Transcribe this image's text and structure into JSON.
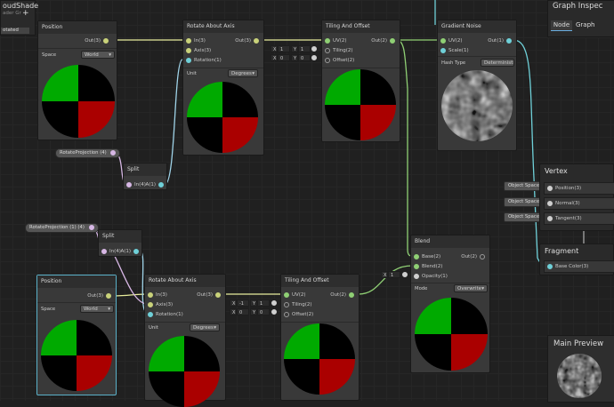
{
  "top_left": {
    "title": "oudShade",
    "subtitle": "ader Gr",
    "button": "otated"
  },
  "graph_inspector": {
    "title": "Graph Inspec",
    "tabs": [
      "Node",
      "Graph"
    ]
  },
  "position_top": {
    "title": "Position",
    "out": "Out(3)",
    "space_label": "Space",
    "space_value": "World"
  },
  "rotate_top": {
    "title": "Rotate About Axis",
    "inputs": [
      "In(3)",
      "Axis(3)",
      "Rotation(1)"
    ],
    "out": "Out(3)",
    "unit_label": "Unit",
    "unit_value": "Degrees"
  },
  "tiling_top": {
    "title": "Tiling And Offset",
    "inputs": [
      "UV(2)",
      "Tiling(2)",
      "Offset(2)"
    ],
    "out": "Out(2)",
    "tiling_vals": {
      "x_label": "X",
      "x": "1",
      "y_label": "Y",
      "y": "1"
    },
    "offset_vals": {
      "x_label": "X",
      "x": "0",
      "y_label": "Y",
      "y": "0"
    }
  },
  "gradient_noise": {
    "title": "Gradient Noise",
    "inputs": [
      "UV(2)",
      "Scale(1)"
    ],
    "out": "Out(1)",
    "hash_label": "Hash Type",
    "hash_value": "Deterministi"
  },
  "rotate_prop_top": {
    "label": "RotateProjection (4)"
  },
  "split_top": {
    "title": "Split",
    "input": "In(4)",
    "out": "A(1)"
  },
  "rotate_prop_bottom": {
    "label": "RotateProjection (1) (4)"
  },
  "split_bottom": {
    "title": "Split",
    "input": "In(4)",
    "out": "A(1)"
  },
  "position_bottom": {
    "title": "Position",
    "out": "Out(3)",
    "space_label": "Space",
    "space_value": "World"
  },
  "rotate_bottom": {
    "title": "Rotate About Axis",
    "inputs": [
      "In(3)",
      "Axis(3)",
      "Rotation(1)"
    ],
    "out": "Out(3)",
    "unit_label": "Unit",
    "unit_value": "Degrees"
  },
  "tiling_bottom": {
    "title": "Tiling And Offset",
    "inputs": [
      "UV(2)",
      "Tiling(2)",
      "Offset(2)"
    ],
    "out": "Out(2)",
    "tiling_vals": {
      "x_label": "X",
      "x": "-1",
      "y_label": "Y",
      "y": "1"
    },
    "offset_vals": {
      "x_label": "X",
      "x": "0",
      "y_label": "Y",
      "y": "0"
    }
  },
  "blend": {
    "title": "Blend",
    "inputs": [
      "Base(2)",
      "Blend(2)",
      "Opacity(1)"
    ],
    "out": "Out(2)",
    "mode_label": "Mode",
    "mode_value": "Overwrite",
    "opacity_x_label": "X",
    "opacity_x": "1"
  },
  "vertex": {
    "title": "Vertex",
    "slots": [
      "Position(3)",
      "Normal(3)",
      "Tangent(3)"
    ],
    "chips": [
      "Object Space",
      "Object Space",
      "Object Space"
    ]
  },
  "fragment": {
    "title": "Fragment",
    "slots": [
      "Base Color(3)"
    ]
  },
  "main_preview": {
    "title": "Main Preview"
  }
}
